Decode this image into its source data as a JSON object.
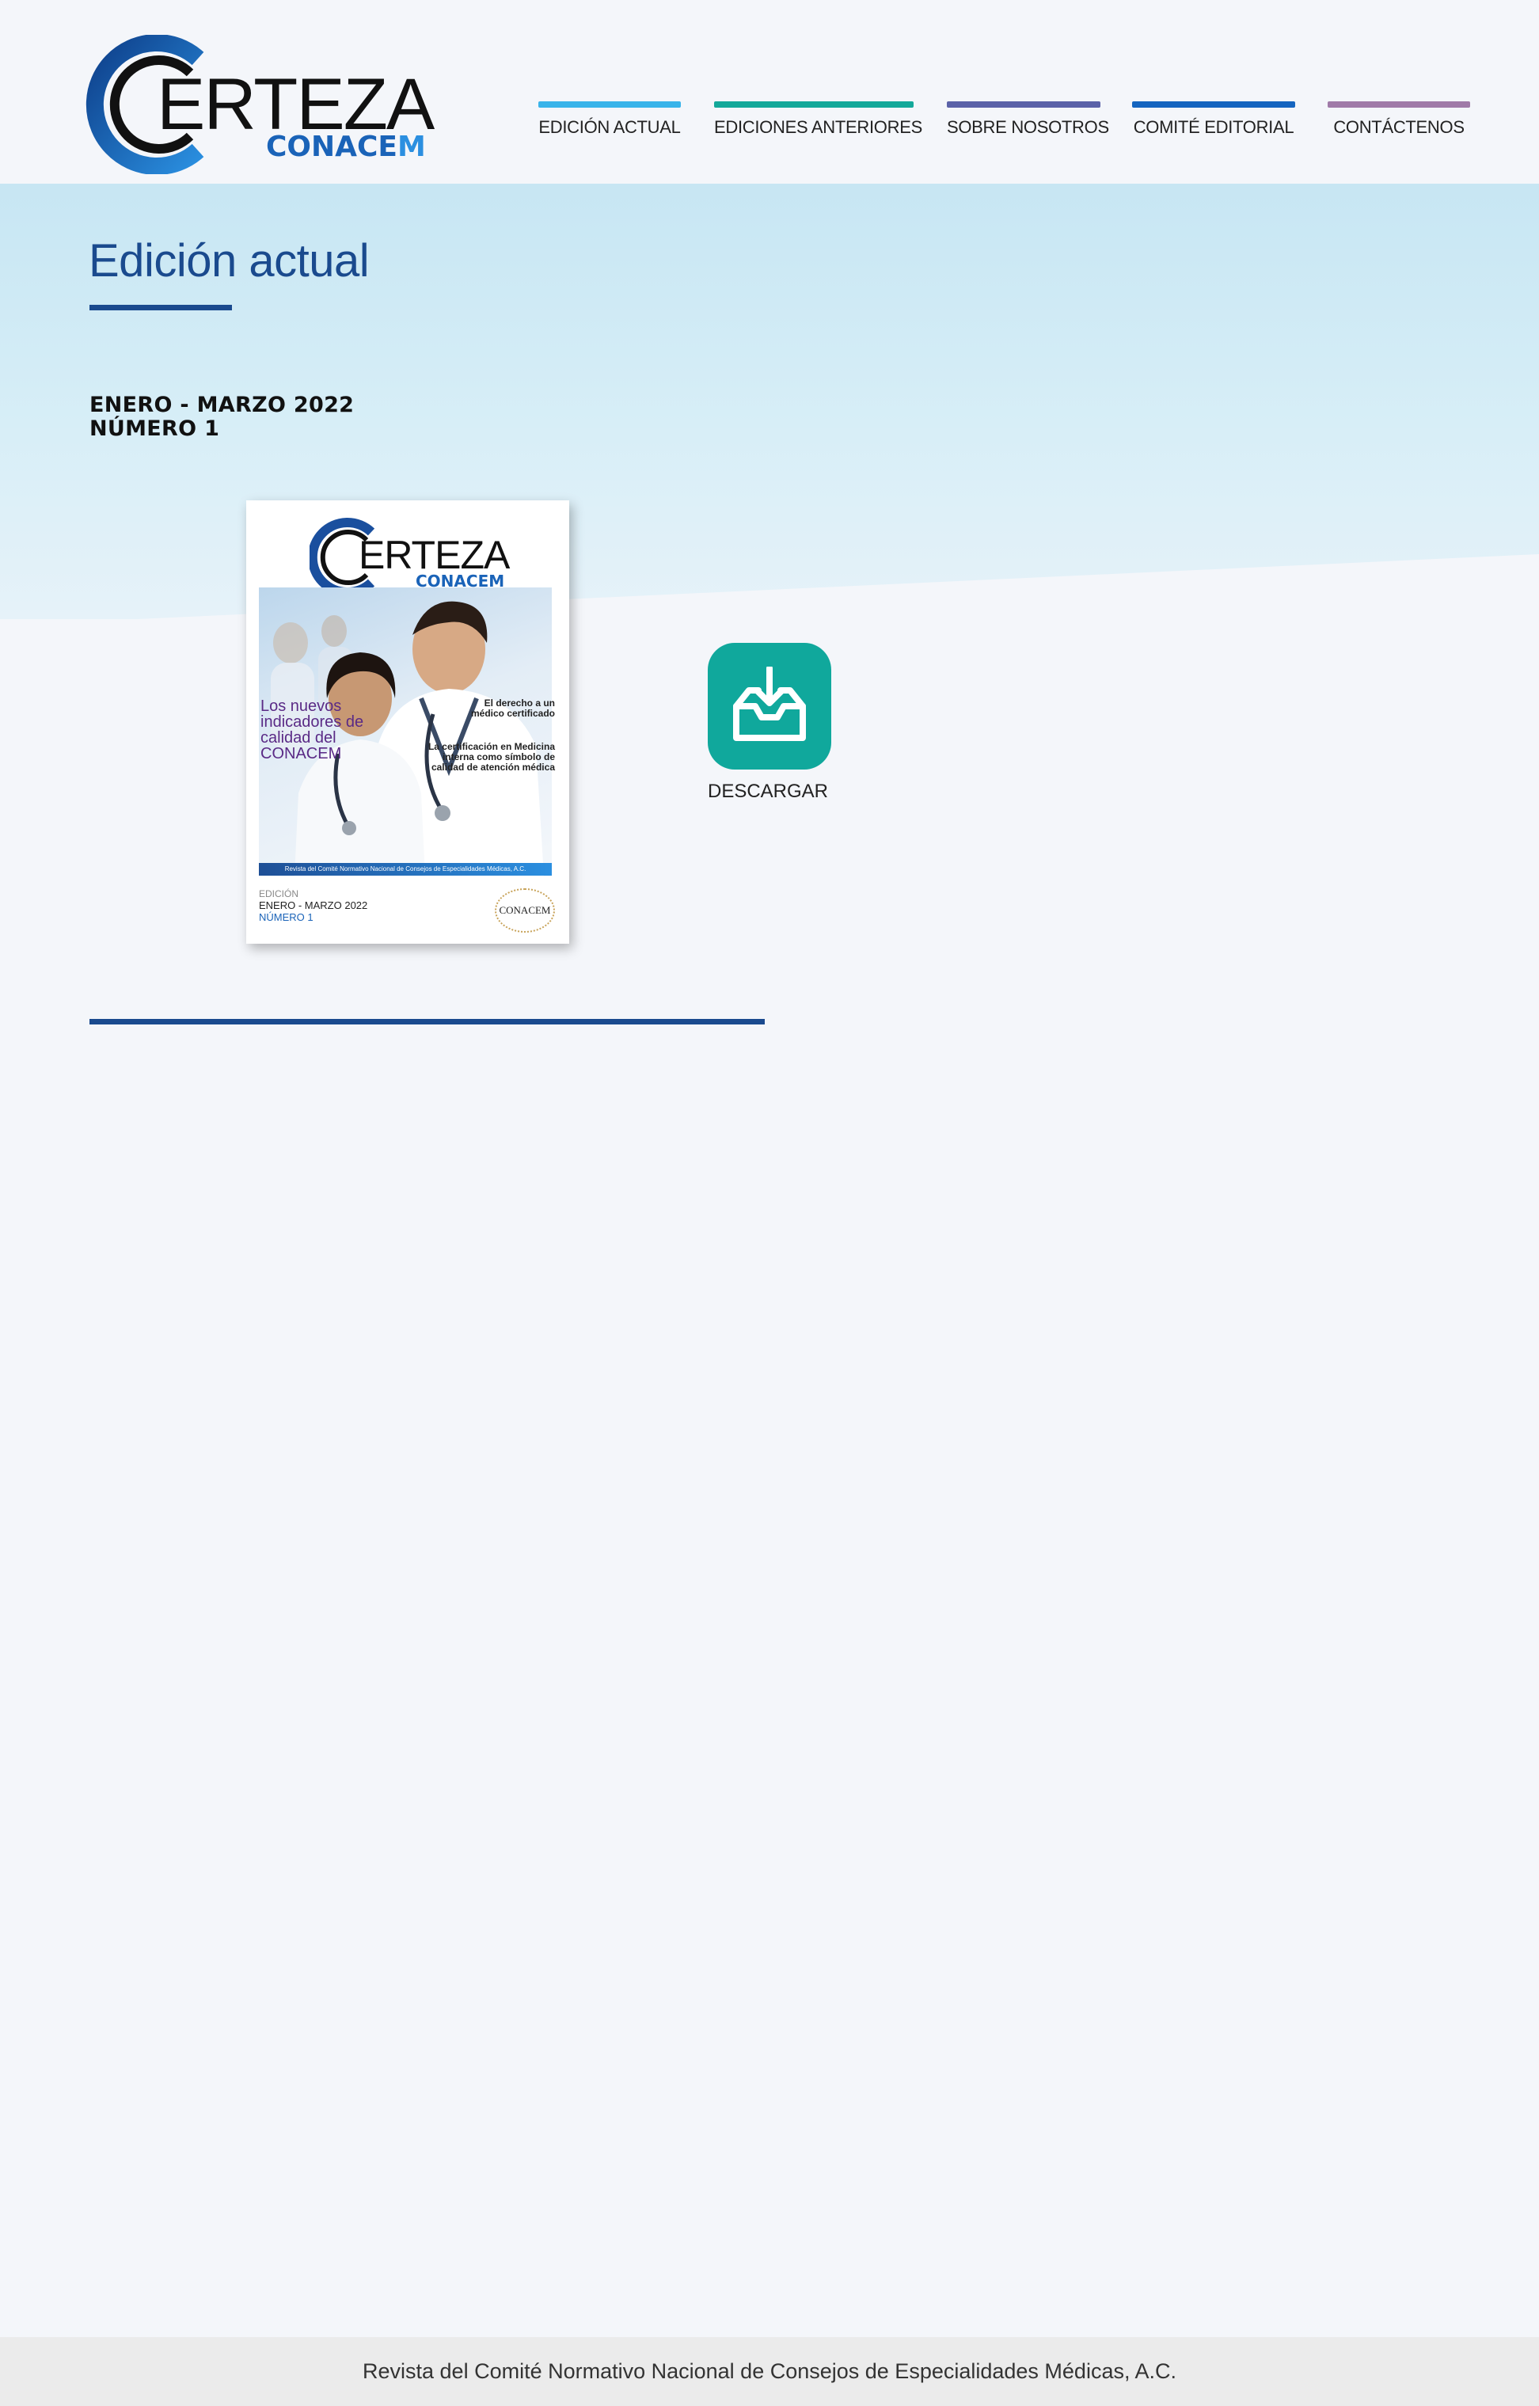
{
  "brand": {
    "logo_word": "ERTEZA",
    "logo_sub_main": "CONACE",
    "logo_sub_end": "M",
    "primary_color": "#1a4a8e",
    "accent_color": "#2b8fe0"
  },
  "nav": {
    "items": [
      {
        "label": "EDICIÓN ACTUAL",
        "color": "#3ab4ea"
      },
      {
        "label": "EDICIONES ANTERIORES",
        "color": "#14a89a"
      },
      {
        "label": "SOBRE NOSOTROS",
        "color": "#5b62a8"
      },
      {
        "label": "COMITÉ EDITORIAL",
        "color": "#1565c0"
      },
      {
        "label": "CONTÁCTENOS",
        "color": "#a07aa8"
      }
    ]
  },
  "main": {
    "title": "Edición actual",
    "issue_date": "ENERO - MARZO 2022",
    "issue_number": "NÚMERO 1"
  },
  "cover": {
    "logo_word": "ERTEZA",
    "logo_sub": "CONACEM",
    "headline": "Los nuevos indicadores de calidad del CONACEM",
    "side_text_1": "El derecho a un médico certificado",
    "side_text_2": "La certificación en Medicina interna como símbolo de calidad de atención médica",
    "strip_text": "Revista del Comité Normativo Nacional de Consejos de Especialidades Médicas, A.C.",
    "edicion_label": "EDICIÓN",
    "date": "ENERO - MARZO 2022",
    "number": "NÚMERO 1",
    "seal_text": "CONACEM"
  },
  "download": {
    "label": "DESCARGAR",
    "color": "#10a89c",
    "icon": "download-tray-icon"
  },
  "footer": {
    "text": "Revista del Comité Normativo Nacional de Consejos de Especialidades Médicas, A.C."
  }
}
